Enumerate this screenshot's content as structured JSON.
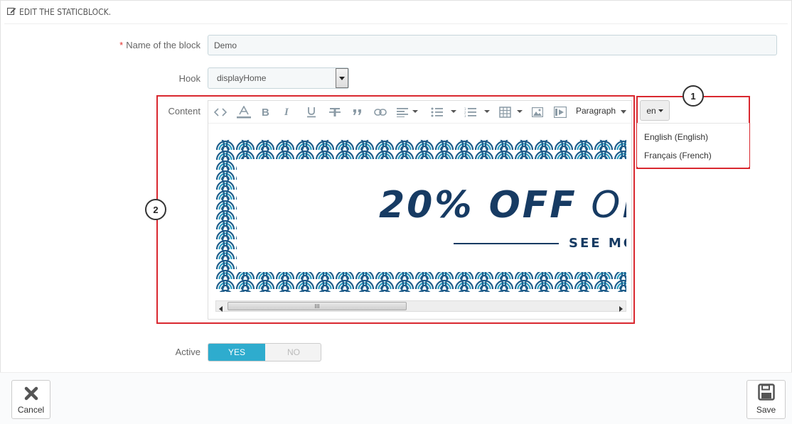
{
  "header": {
    "title": "EDIT THE STATICBLOCK.",
    "icon": "edit-icon"
  },
  "form": {
    "name_label": "Name of the block",
    "name_value": "Demo",
    "hook_label": "Hook",
    "hook_value": "displayHome",
    "content_label": "Content",
    "active_label": "Active",
    "active_yes": "YES",
    "active_no": "NO",
    "active_value": "YES"
  },
  "editor": {
    "toolbar": [
      "code-icon",
      "text-color-icon",
      "bold-icon",
      "italic-icon",
      "underline-icon",
      "strikethrough-icon",
      "blockquote-icon",
      "link-icon",
      "align-icon",
      "bullet-list-icon",
      "numbered-list-icon",
      "table-icon",
      "image-icon",
      "media-icon"
    ],
    "format_label": "Paragraph",
    "banner": {
      "headline_bold": "20% OFF",
      "headline_light": "ON",
      "subline": "SEE MO",
      "pattern_color": "#1e5c8a",
      "accent_color": "#2b9fc4",
      "text_color": "#173b63"
    },
    "scroll_thumb_glyph": "III"
  },
  "language": {
    "current": "en",
    "options": [
      "English (English)",
      "Français (French)"
    ]
  },
  "callouts": {
    "one": "1",
    "two": "2"
  },
  "footer": {
    "cancel_label": "Cancel",
    "save_label": "Save"
  },
  "colors": {
    "highlight_red": "#d9282f",
    "switch_blue": "#2eacce",
    "required_red": "#e3302c"
  }
}
